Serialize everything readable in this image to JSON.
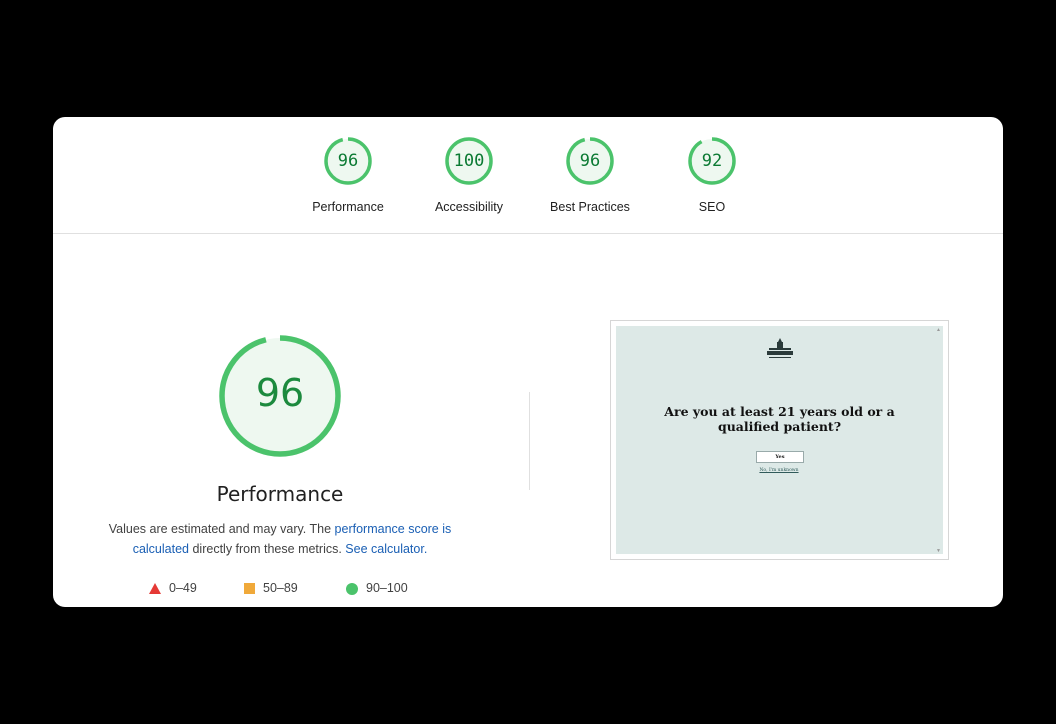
{
  "categories": [
    {
      "score": "96",
      "label": "Performance",
      "fraction": 0.96
    },
    {
      "score": "100",
      "label": "Accessibility",
      "fraction": 1.0
    },
    {
      "score": "96",
      "label": "Best Practices",
      "fraction": 0.96
    },
    {
      "score": "92",
      "label": "SEO",
      "fraction": 0.92
    }
  ],
  "performance": {
    "score": "96",
    "fraction": 0.96,
    "title": "Performance",
    "desc_prefix": "Values are estimated and may vary. The ",
    "desc_link1": "performance score is calculated",
    "desc_middle": " directly from these metrics. ",
    "desc_link2": "See calculator.",
    "legend": [
      {
        "symbol": "triangle",
        "range": "0–49",
        "color": "#e53935"
      },
      {
        "symbol": "square",
        "range": "50–89",
        "color": "#f0a93a"
      },
      {
        "symbol": "circle",
        "range": "90–100",
        "color": "#4bc36b"
      }
    ]
  },
  "screenshot": {
    "question": "Are you at least 21 years old or a qualified patient?",
    "yes_label": "Yes",
    "no_link": "No, I'm unknown",
    "logo_text": "CANNABIS"
  },
  "colors": {
    "pass_green": "#0b7a33",
    "gauge_ring": "#4bc36b",
    "gauge_fill": "#eef8f0",
    "link_blue": "#1a5fb4",
    "screenshot_bg": "#dde9e7"
  }
}
